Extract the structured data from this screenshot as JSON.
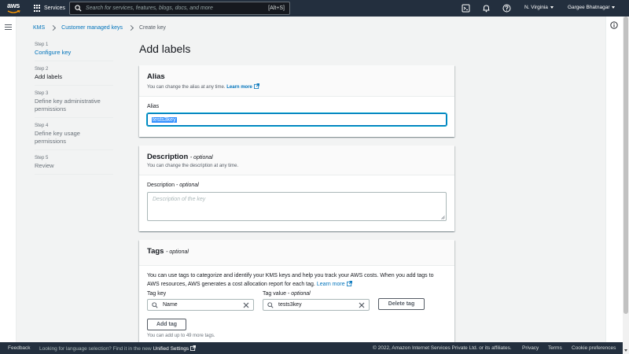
{
  "topnav": {
    "logo_text": "aws",
    "services_label": "Services",
    "search_placeholder": "Search for services, features, blogs, docs, and more",
    "search_shortcut": "[Alt+S]",
    "region": "N. Virginia",
    "user": "Gargee Bhatnagar"
  },
  "breadcrumb": {
    "items": [
      "KMS",
      "Customer managed keys"
    ],
    "current": "Create key"
  },
  "steps": [
    {
      "num": "Step 1",
      "label": "Configure key"
    },
    {
      "num": "Step 2",
      "label": "Add labels"
    },
    {
      "num": "Step 3",
      "label": "Define key administrative permissions"
    },
    {
      "num": "Step 4",
      "label": "Define key usage permissions"
    },
    {
      "num": "Step 5",
      "label": "Review"
    }
  ],
  "page_title": "Add labels",
  "alias_card": {
    "title": "Alias",
    "desc": "You can change the alias at any time.",
    "learn_more": "Learn more",
    "field_label": "Alias",
    "value": "tests3key"
  },
  "description_card": {
    "title": "Description",
    "optional": "- optional",
    "desc": "You can change the description at any time.",
    "field_label": "Description",
    "field_optional": "- optional",
    "placeholder": "Description of the key"
  },
  "tags_card": {
    "title": "Tags",
    "optional": "- optional",
    "text": "You can use tags to categorize and identify your KMS keys and help you track your AWS costs. When you add tags to AWS resources, AWS generates a cost allocation report for each tag.",
    "learn_more": "Learn more",
    "tag_key_label": "Tag key",
    "tag_value_label": "Tag value",
    "tag_value_optional": "- optional",
    "tag_key": "Name",
    "tag_value": "tests3key",
    "delete_button": "Delete tag",
    "add_button": "Add tag",
    "hint": "You can add up to 49 more tags."
  },
  "footer": {
    "feedback": "Feedback",
    "language_text": "Looking for language selection? Find it in the new",
    "unified_settings": "Unified Settings",
    "copyright": "© 2022, Amazon Internet Services Private Ltd. or its affiliates.",
    "privacy": "Privacy",
    "terms": "Terms",
    "cookies": "Cookie preferences"
  },
  "colors": {
    "nav_bg": "#232f3e",
    "link": "#0073bb",
    "accent": "#ff9900"
  }
}
